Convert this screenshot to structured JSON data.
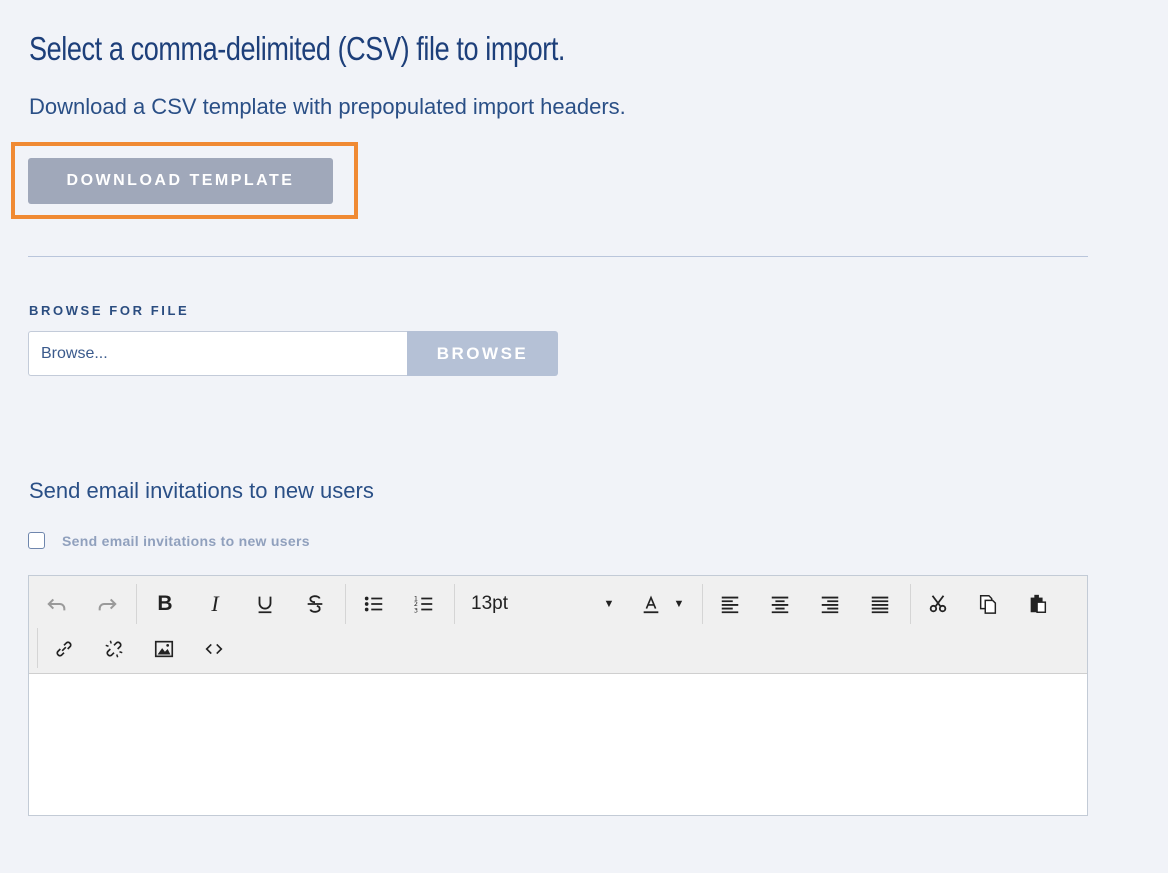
{
  "header": {
    "title": "Select a comma-delimited (CSV) file to import.",
    "subtitle": "Download a CSV template with prepopulated import headers."
  },
  "download": {
    "button_label": "DOWNLOAD TEMPLATE",
    "highlight_color": "#f08a33"
  },
  "browse": {
    "label": "BROWSE FOR FILE",
    "input_placeholder": "Browse...",
    "button_label": "BROWSE"
  },
  "invitations": {
    "section_title": "Send email invitations to new users",
    "checkbox_label": "Send email invitations to new users",
    "checkbox_checked": false
  },
  "editor": {
    "toolbar": {
      "font_size": "13pt",
      "icons": [
        "undo-icon",
        "redo-icon",
        "bold-icon",
        "italic-icon",
        "underline-icon",
        "strikethrough-icon",
        "bulleted-list-icon",
        "numbered-list-icon",
        "font-color-icon",
        "align-left-icon",
        "align-center-icon",
        "align-right-icon",
        "justify-icon",
        "cut-icon",
        "copy-icon",
        "paste-icon",
        "link-icon",
        "unlink-icon",
        "image-icon",
        "code-icon"
      ]
    },
    "content": ""
  },
  "colors": {
    "background": "#f1f3f8",
    "primary_text": "#1d3f7a",
    "download_button": "#a0a8ba",
    "browse_button": "#b5c1d6"
  }
}
